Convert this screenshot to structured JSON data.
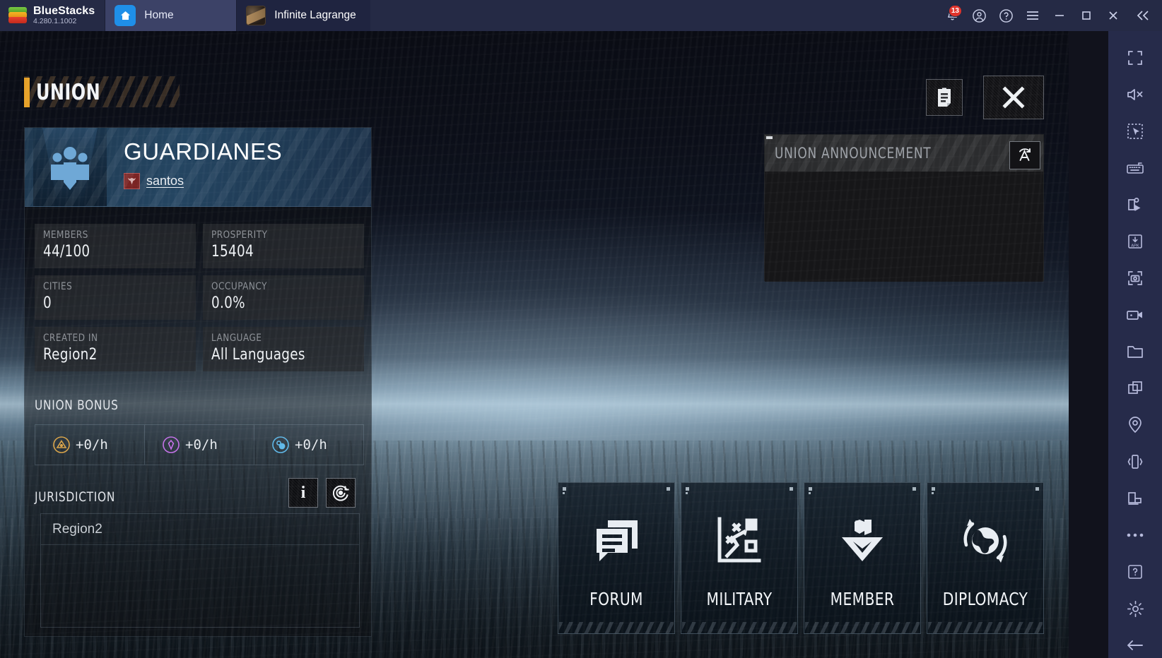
{
  "bluestacks": {
    "brand_name": "BlueStacks",
    "version": "4.280.1.1002",
    "tabs": [
      {
        "label": "Home",
        "icon": "home-icon"
      },
      {
        "label": "Infinite Lagrange",
        "icon": "game-thumbnail"
      }
    ],
    "system_buttons": [
      {
        "name": "notifications-button",
        "icon": "bell-icon",
        "badge": "13"
      },
      {
        "name": "account-button",
        "icon": "user-circle-icon"
      },
      {
        "name": "help-button",
        "icon": "question-circle-icon"
      },
      {
        "name": "menu-button",
        "icon": "hamburger-icon"
      },
      {
        "name": "minimize-button",
        "icon": "minimize-icon"
      },
      {
        "name": "maximize-button",
        "icon": "maximize-icon"
      },
      {
        "name": "close-window-button",
        "icon": "close-icon"
      },
      {
        "name": "collapse-sidebar-button",
        "icon": "double-chevron-left-icon"
      }
    ],
    "sidebar_icons": [
      "fullscreen-icon",
      "mute-icon",
      "multi-select-icon",
      "keyboard-controls-icon",
      "macro-recorder-icon",
      "install-apk-icon",
      "screenshot-icon",
      "screen-record-icon",
      "media-manager-icon",
      "multi-instance-icon",
      "location-icon",
      "shake-icon",
      "rotate-screen-icon",
      "more-options-icon",
      "help-icon",
      "settings-icon",
      "back-icon"
    ]
  },
  "game": {
    "header": {
      "title": "UNION",
      "notebook_button": "union-log-button",
      "close_button": "close-union-panel-button"
    },
    "union": {
      "name": "GUARDIANES",
      "leader_label": "santos",
      "crest_icon": "union-members-crest-icon",
      "leader_badge_icon": "leader-rank-icon",
      "stats": [
        {
          "label": "MEMBERS",
          "value": "44/100"
        },
        {
          "label": "PROSPERITY",
          "value": "15404"
        },
        {
          "label": "CITIES",
          "value": "0"
        },
        {
          "label": "OCCUPANCY",
          "value": "0.0%"
        },
        {
          "label": "CREATED IN",
          "value": "Region2"
        },
        {
          "label": "LANGUAGE",
          "value": "All Languages"
        }
      ],
      "bonus_title": "UNION BONUS",
      "bonuses": [
        {
          "icon": "metal-resource-icon",
          "value": "+0/h",
          "color": "#d9a44a"
        },
        {
          "icon": "crystal-resource-icon",
          "value": "+0/h",
          "color": "#c471e8"
        },
        {
          "icon": "deuterium-resource-icon",
          "value": "+0/h",
          "color": "#5fb8e8"
        }
      ],
      "jurisdiction_title": "JURISDICTION",
      "jurisdiction_info_button": "jurisdiction-info-button",
      "jurisdiction_map_button": "jurisdiction-map-button",
      "jurisdiction_items": [
        "Region2"
      ]
    },
    "announcement": {
      "title": "UNION ANNOUNCEMENT",
      "body": "",
      "translate_button": "translate-announcement-button"
    },
    "tiles": [
      {
        "label": "FORUM",
        "icon": "forum-chat-icon"
      },
      {
        "label": "MILITARY",
        "icon": "military-strategy-icon"
      },
      {
        "label": "MEMBER",
        "icon": "member-rank-icon"
      },
      {
        "label": "DIPLOMACY",
        "icon": "diplomacy-globe-icon"
      }
    ]
  },
  "colors": {
    "accent_orange": "#e6a128",
    "panel_blue": "#244561",
    "badge_red": "#e0342c",
    "sidebar_navy": "#262b4a"
  }
}
